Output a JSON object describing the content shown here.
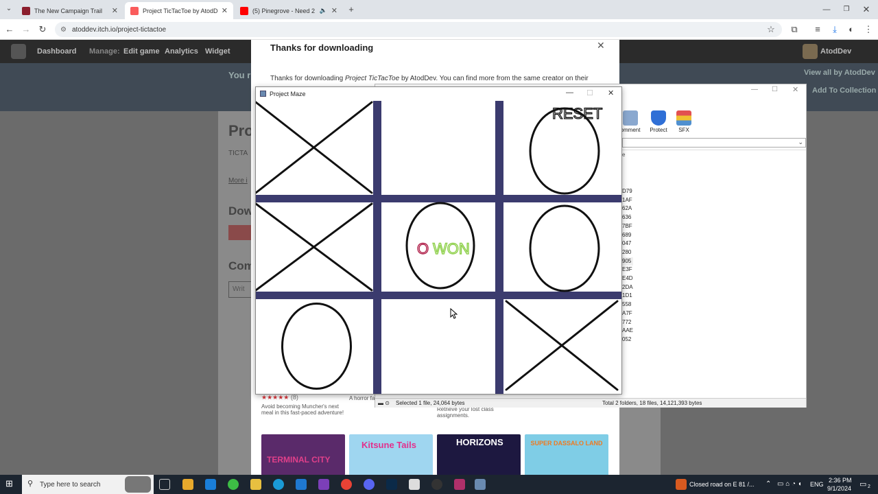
{
  "browser": {
    "tabs": [
      {
        "title": "The New Campaign Trail",
        "color": "#8b1e2d"
      },
      {
        "title": "Project TicTacToe by AtodDev",
        "color": "#fa5c5c"
      },
      {
        "title": "(5) Pinegrove - Need 2 (offi",
        "color": "#ff0000"
      }
    ],
    "url": "atoddev.itch.io/project-tictactoe"
  },
  "dashboard": {
    "logo": "itch",
    "nav": [
      "Dashboard",
      "Manage:",
      "Edit game",
      "Analytics",
      "Widget"
    ],
    "user": "AtodDev",
    "view_all": "View all by AtodDev",
    "add_to_collection": "Add To Collection",
    "bg_heading1": "Pro",
    "bg_heading2": "Dow",
    "bg_heading3": "Com",
    "bg_small1": "You r",
    "bg_small2": "TICTA",
    "bg_small3": "More i",
    "bg_small4": "Writ"
  },
  "modal": {
    "title": "Thanks for downloading",
    "text_prefix": "Thanks for downloading ",
    "game_name": "Project TicTacToe",
    "text_suffix": " by AtodDev. You can find more from the same creator on their",
    "rating_count": "(8)",
    "card1_desc": "Avoid becoming Muncher's next meal in this fast-paced adventure!",
    "card2_desc": "A horror fa",
    "card3_desc": "Retrieve your lost class assignments.",
    "thumbs": [
      {
        "label": "TERMINAL CITY",
        "color": "#5a2a6a"
      },
      {
        "label": "Kitsune Tails",
        "color": "#9fd6f0"
      },
      {
        "label": "HORIZONS",
        "color": "#1d1840"
      },
      {
        "label": "SUPER DASSALO LAND",
        "color": "#7fcde6"
      }
    ]
  },
  "winrar": {
    "tools": [
      "omment",
      "Protect",
      "SFX"
    ],
    "list": [
      "D79",
      "1AF",
      "62A",
      "636",
      "7BF",
      "689",
      "047",
      "280",
      "905",
      "E3F",
      "E4D",
      "2DA",
      "1D1",
      "558",
      "A7F",
      "772",
      "AAE",
      "052"
    ],
    "status_left": "Selected 1 file, 24,064 bytes",
    "status_right": "Total 2 folders, 18 files, 14,121,393 bytes",
    "col_header": "e"
  },
  "game": {
    "window_title": "Project Maze",
    "reset_label": "RESET",
    "win_symbol": "O",
    "win_text": "WON",
    "grid_color": "#3b3b6e",
    "board": [
      "X",
      "",
      "O",
      "X",
      "",
      "O",
      "O",
      "",
      "X"
    ]
  },
  "taskbar": {
    "search_placeholder": "Type here to search",
    "notification": "Closed road on E 81 /...",
    "lang": "ENG",
    "time": "2:36 PM",
    "date": "9/1/2024",
    "badge": "2"
  }
}
